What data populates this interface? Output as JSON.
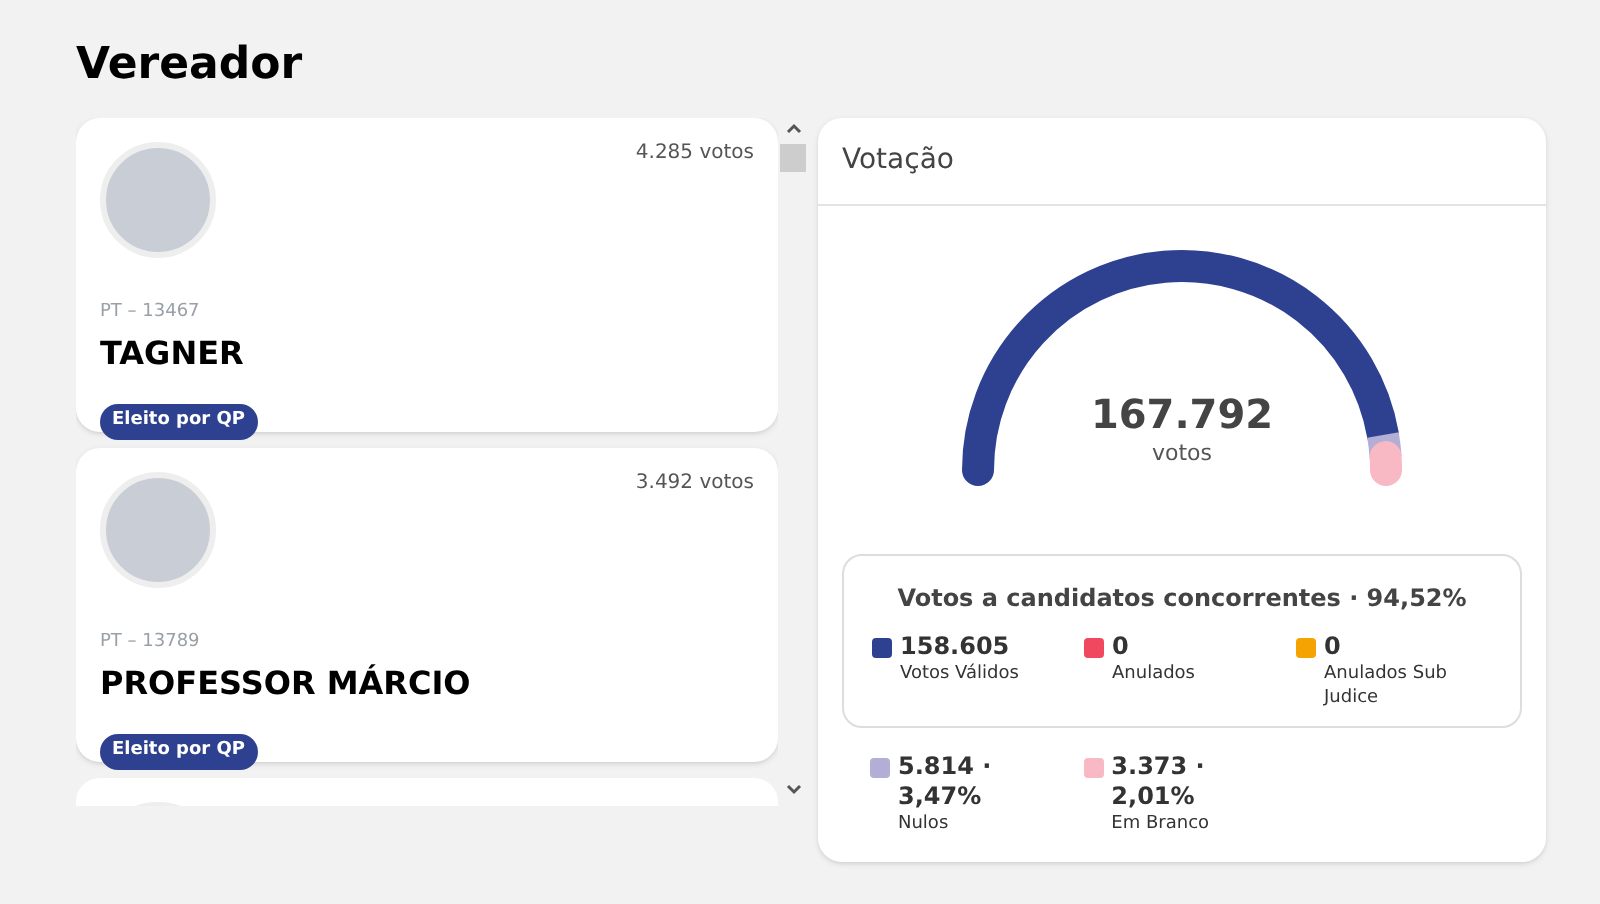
{
  "page_title": "Vereador",
  "candidates": [
    {
      "votes": "4.285 votos",
      "party": "PT – 13467",
      "name": "TAGNER",
      "badge": "Eleito por QP"
    },
    {
      "votes": "3.492 votos",
      "party": "PT – 13789",
      "name": "PROFESSOR MÁRCIO",
      "badge": "Eleito por QP"
    }
  ],
  "panel": {
    "title": "Votação",
    "total": "167.792",
    "total_label": "votos",
    "box_title": "Votos a candidatos concorrentes · 94,52%",
    "box_items": [
      {
        "value": "158.605",
        "label": "Votos Válidos",
        "color": "#2e4191"
      },
      {
        "value": "0",
        "label": "Anulados",
        "color": "#f0485f"
      },
      {
        "value": "0",
        "label": "Anulados Sub Judice",
        "color": "#f5a300"
      }
    ],
    "other_items": [
      {
        "value": "5.814 · 3,47%",
        "label": "Nulos",
        "color": "#b3aed6"
      },
      {
        "value": "3.373 · 2,01%",
        "label": "Em Branco",
        "color": "#f8b9c4"
      }
    ]
  }
}
